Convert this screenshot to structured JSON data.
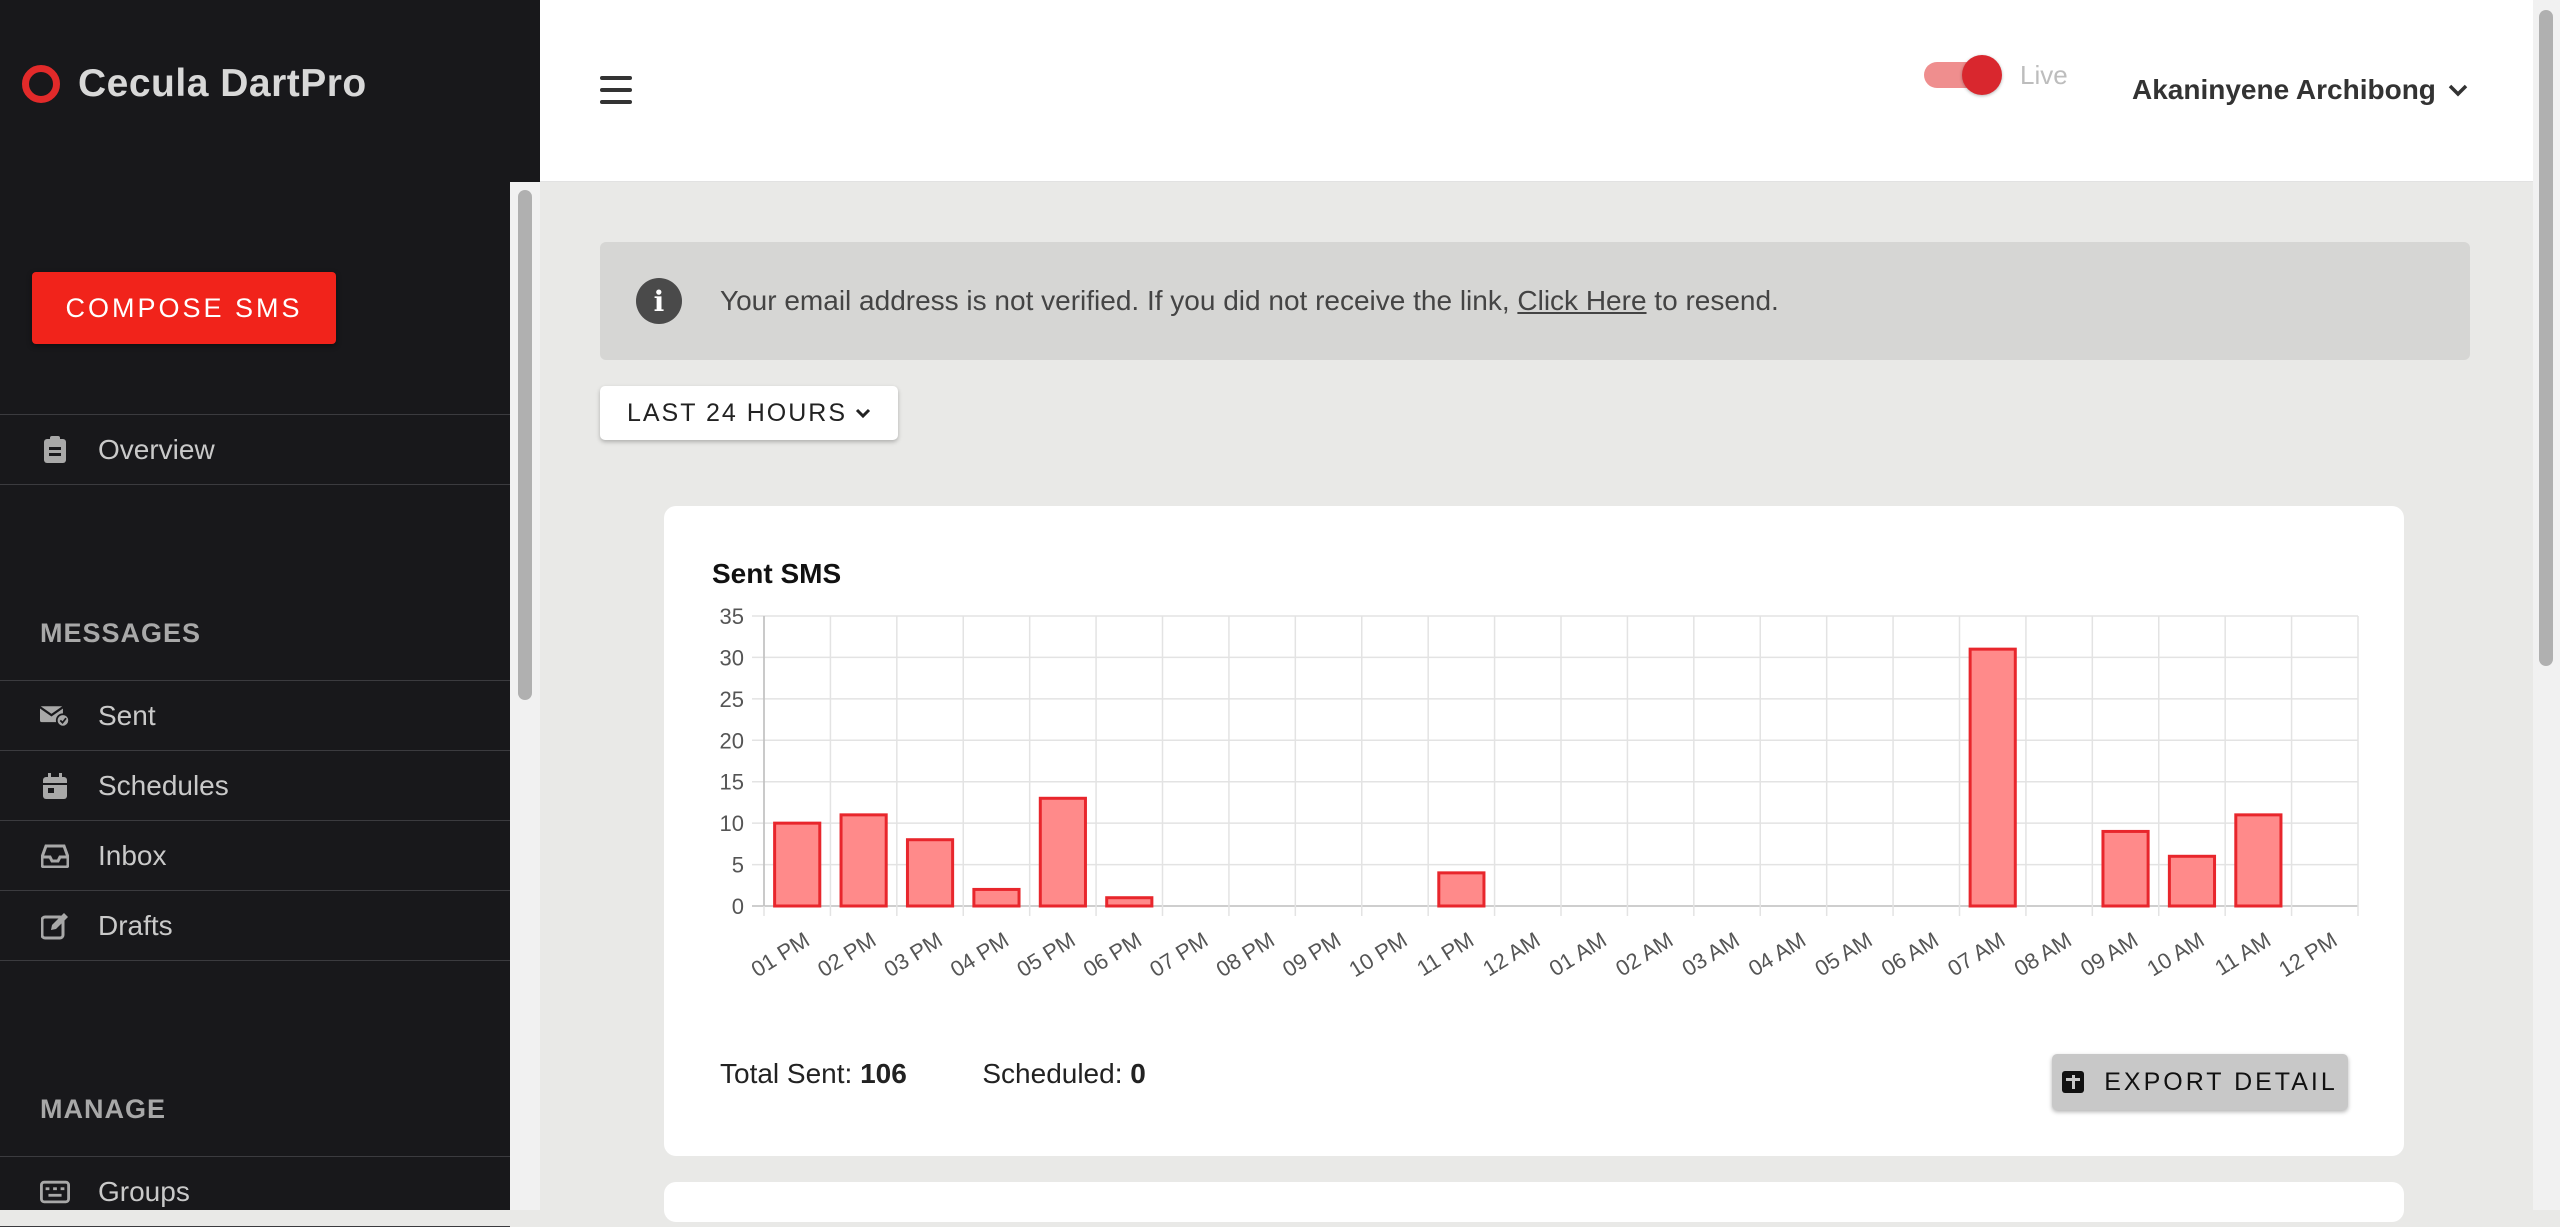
{
  "brand": {
    "name": "Cecula DartPro"
  },
  "sidebar": {
    "compose_label": "COMPOSE SMS",
    "overview": "Overview",
    "messages_heading": "MESSAGES",
    "messages": [
      {
        "label": "Sent",
        "icon": "envelope-check-icon"
      },
      {
        "label": "Schedules",
        "icon": "calendar-icon"
      },
      {
        "label": "Inbox",
        "icon": "inbox-icon"
      },
      {
        "label": "Drafts",
        "icon": "edit-icon"
      }
    ],
    "manage_heading": "MANAGE",
    "manage": [
      {
        "label": "Groups",
        "icon": "keyboard-icon"
      }
    ]
  },
  "header": {
    "live_label": "Live",
    "user_name": "Akaninyene Archibong"
  },
  "alert": {
    "text_before": "Your email address is not verified. If you did not receive the link, ",
    "link_text": "Click Here",
    "text_after": " to resend."
  },
  "filter": {
    "range_label": "LAST 24 HOURS"
  },
  "stats": {
    "total_sent_label": "Total Sent:",
    "total_sent_value": "106",
    "scheduled_label": "Scheduled:",
    "scheduled_value": "0",
    "export_label": "EXPORT DETAIL"
  },
  "chart_data": {
    "type": "bar",
    "title": "Sent SMS",
    "categories": [
      "01 PM",
      "02 PM",
      "03 PM",
      "04 PM",
      "05 PM",
      "06 PM",
      "07 PM",
      "08 PM",
      "09 PM",
      "10 PM",
      "11 PM",
      "12 AM",
      "01 AM",
      "02 AM",
      "03 AM",
      "04 AM",
      "05 AM",
      "06 AM",
      "07 AM",
      "08 AM",
      "09 AM",
      "10 AM",
      "11 AM",
      "12 PM"
    ],
    "values": [
      10,
      11,
      8,
      2,
      13,
      1,
      0,
      0,
      0,
      0,
      4,
      0,
      0,
      0,
      0,
      0,
      0,
      0,
      31,
      0,
      9,
      6,
      11,
      0
    ],
    "ylim": [
      0,
      35
    ],
    "yticks": [
      0,
      5,
      10,
      15,
      20,
      25,
      30,
      35
    ],
    "grid": true,
    "colors": {
      "fill": "#ff8a8a",
      "stroke": "#e8262c"
    }
  }
}
